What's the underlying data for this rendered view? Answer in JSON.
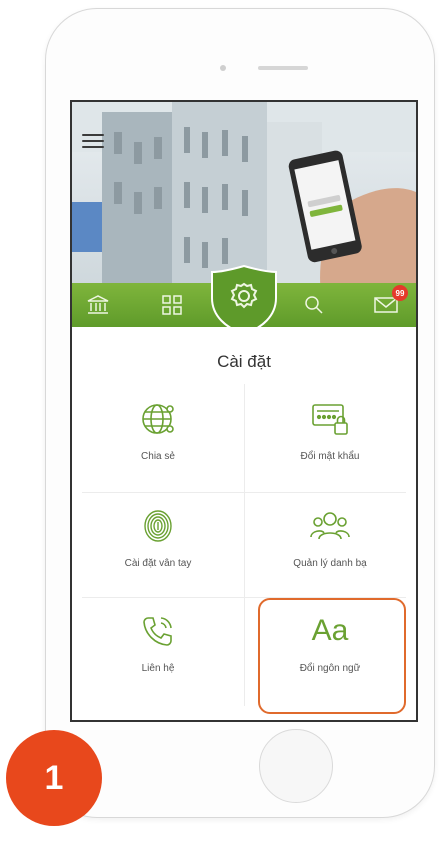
{
  "colors": {
    "accent": "#6aa132",
    "highlight": "#e06a2c",
    "step_badge": "#e8481c",
    "mail_badge": "#e53a2c"
  },
  "hero": {
    "nav_icons": [
      "bank-icon",
      "grid-icon",
      "settings-icon",
      "search-icon",
      "mail-icon"
    ],
    "mail_badge": "99"
  },
  "page": {
    "title": "Cài đặt"
  },
  "tiles": [
    {
      "label": "Chia sẻ",
      "icon": "globe-share-icon"
    },
    {
      "label": "Đổi mật khẩu",
      "icon": "password-lock-icon"
    },
    {
      "label": "Cài đặt vân tay",
      "icon": "fingerprint-icon"
    },
    {
      "label": "Quản lý danh bạ",
      "icon": "contacts-icon"
    },
    {
      "label": "Liên hệ",
      "icon": "phone-icon"
    },
    {
      "label": "Đổi ngôn ngữ",
      "icon": "language-icon",
      "glyph": "Aa"
    }
  ],
  "step": {
    "number": "1"
  }
}
